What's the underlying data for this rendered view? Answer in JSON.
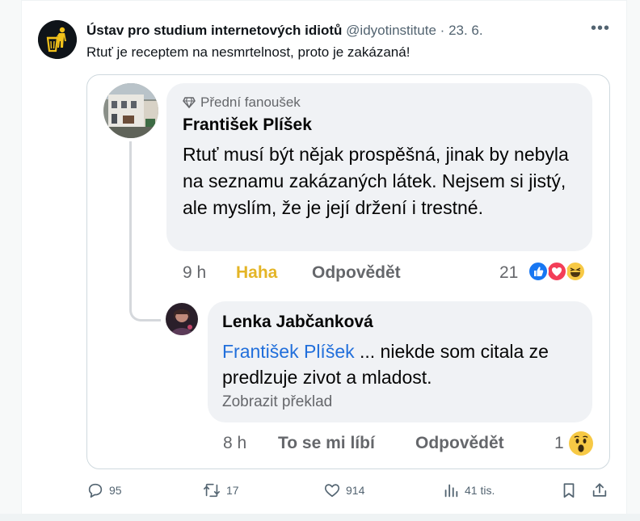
{
  "tweet": {
    "author_name": "Ústav pro studium internetových idiotů",
    "handle": "@idyotinstitute",
    "separator": "·",
    "date": "23. 6.",
    "more_label": "•••",
    "text": "Rtuť je receptem na nesmrtelnost, proto je zakázaná!"
  },
  "comment1": {
    "badge": "Přední fanoušek",
    "author": "František Plíšek",
    "text": "Rtuť musí být nějak prospěšná, jinak by nebyla na seznamu zakázaných látek. Nejsem si jistý, ale myslím, že je její držení i trestné.",
    "time": "9 h",
    "reaction_given": "Haha",
    "reply": "Odpovědět",
    "reaction_count": "21",
    "reaction_icons": [
      "like-icon",
      "love-icon",
      "haha-icon"
    ]
  },
  "comment2": {
    "author": "Lenka Jabčanková",
    "mention": "František Plíšek",
    "text": " ... niekde som citala ze predlzuje zivot a mladost.",
    "translate": "Zobrazit překlad",
    "time": "8 h",
    "like": "To se mi líbí",
    "reply": "Odpovědět",
    "reaction_count": "1",
    "reaction_icons": [
      "wow-icon"
    ]
  },
  "actions": {
    "replies": "95",
    "reposts": "17",
    "likes": "914",
    "views": "41 tis."
  },
  "colors": {
    "facebook_blue": "#216fdb",
    "haha_yellow": "#e4b527",
    "bubble_gray": "#f0f2f5",
    "muted": "#536471"
  }
}
